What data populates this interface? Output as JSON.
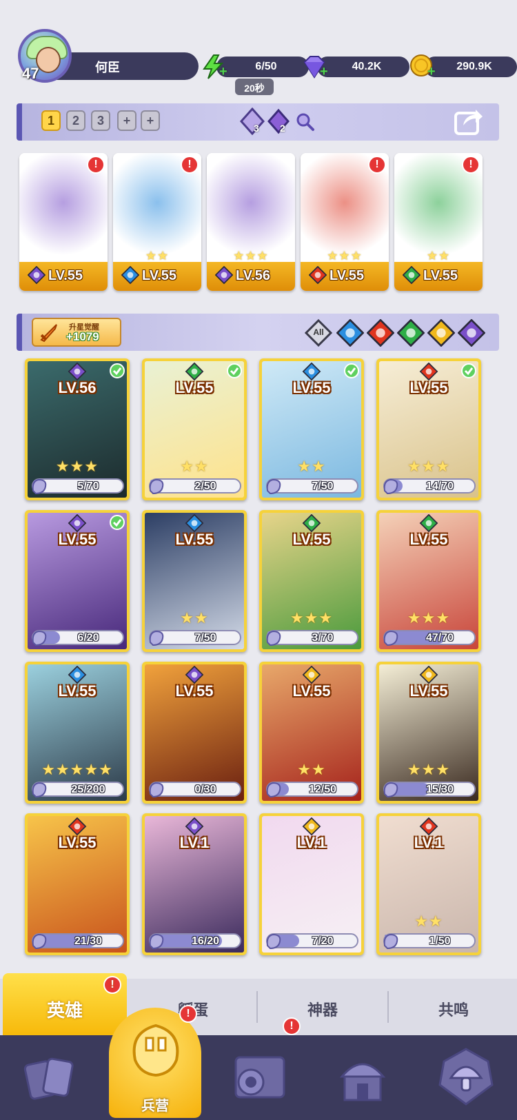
{
  "player": {
    "level": "47",
    "name": "何臣"
  },
  "resources": {
    "energy": {
      "value": "6/50",
      "icon": "lightning-icon",
      "timer": "20秒"
    },
    "gems": {
      "value": "40.2K",
      "icon": "diamond-icon"
    },
    "gold": {
      "value": "290.9K",
      "icon": "coin-icon"
    }
  },
  "team_bar": {
    "slots": [
      "1",
      "2",
      "3"
    ],
    "add_slots": [
      "+",
      "+"
    ],
    "active_slot": "1",
    "counters": [
      {
        "icon": "crystal-icon",
        "value": "3"
      },
      {
        "icon": "moon-crystal-icon",
        "value": "2"
      }
    ]
  },
  "team": [
    {
      "level": "LV.55",
      "element": "moon",
      "stars": "",
      "alert": "!"
    },
    {
      "level": "LV.55",
      "element": "water",
      "stars": "★★",
      "alert": "!"
    },
    {
      "level": "LV.56",
      "element": "moon",
      "stars": "★★★",
      "alert": ""
    },
    {
      "level": "LV.55",
      "element": "fire",
      "stars": "★★★",
      "alert": "!"
    },
    {
      "level": "LV.55",
      "element": "nature",
      "stars": "★★",
      "alert": "!"
    }
  ],
  "filter": {
    "awaken_label": "升星觉醒",
    "awaken_value": "+1079",
    "all_label": "All",
    "elements": [
      "water",
      "fire",
      "nature",
      "light",
      "moon"
    ]
  },
  "heroes": [
    {
      "level": "LV.56",
      "element": "moon",
      "stars": "★★★",
      "progress": "5/70",
      "ratio": 0.07,
      "ready": true,
      "bg": [
        "#3b6b6c",
        "#1c2a2c"
      ]
    },
    {
      "level": "LV.55",
      "element": "nature",
      "stars": "★★",
      "progress": "2/50",
      "ratio": 0.04,
      "ready": true,
      "bg": [
        "#e9f1d4",
        "#ffe28a"
      ]
    },
    {
      "level": "LV.55",
      "element": "water",
      "stars": "★★",
      "progress": "7/50",
      "ratio": 0.14,
      "ready": true,
      "bg": [
        "#cfe9f6",
        "#7bb8e0"
      ]
    },
    {
      "level": "LV.55",
      "element": "fire",
      "stars": "★★★",
      "progress": "14/70",
      "ratio": 0.2,
      "ready": true,
      "bg": [
        "#f6edd6",
        "#d9c28a"
      ]
    },
    {
      "level": "LV.55",
      "element": "moon",
      "stars": "",
      "progress": "6/20",
      "ratio": 0.3,
      "ready": true,
      "bg": [
        "#b89ae0",
        "#47287a"
      ]
    },
    {
      "level": "LV.55",
      "element": "water",
      "stars": "★★",
      "progress": "7/50",
      "ratio": 0.14,
      "ready": false,
      "bg": [
        "#2c3e64",
        "#d4dbe8"
      ]
    },
    {
      "level": "LV.55",
      "element": "nature",
      "stars": "★★★",
      "progress": "3/70",
      "ratio": 0.04,
      "ready": false,
      "bg": [
        "#e7d48a",
        "#4a9a3c"
      ]
    },
    {
      "level": "LV.55",
      "element": "nature",
      "stars": "★★★",
      "progress": "47/70",
      "ratio": 0.67,
      "ready": false,
      "bg": [
        "#f4d1b8",
        "#c8453a"
      ]
    },
    {
      "level": "LV.55",
      "element": "water",
      "stars": "★★★★★",
      "progress": "25/200",
      "ratio": 0.13,
      "ready": false,
      "bg": [
        "#9bd0de",
        "#2c3a48"
      ]
    },
    {
      "level": "LV.55",
      "element": "moon",
      "stars": "",
      "progress": "0/30",
      "ratio": 0.0,
      "ready": false,
      "bg": [
        "#f1a23c",
        "#6a1f10"
      ]
    },
    {
      "level": "LV.55",
      "element": "light",
      "stars": "★★",
      "progress": "12/50",
      "ratio": 0.24,
      "ready": false,
      "bg": [
        "#e8a86a",
        "#a5231c"
      ]
    },
    {
      "level": "LV.55",
      "element": "light",
      "stars": "★★★",
      "progress": "15/30",
      "ratio": 0.5,
      "ready": false,
      "bg": [
        "#f4eed6",
        "#3a2a20"
      ]
    },
    {
      "level": "LV.55",
      "element": "fire",
      "stars": "",
      "progress": "21/30",
      "ratio": 0.7,
      "ready": false,
      "bg": [
        "#f7c44a",
        "#c8521c"
      ]
    },
    {
      "level": "LV.1",
      "element": "moon",
      "stars": "",
      "progress": "16/20",
      "ratio": 0.8,
      "ready": false,
      "bg": [
        "#e9b7d8",
        "#3a2a5c"
      ]
    },
    {
      "level": "LV.1",
      "element": "light",
      "stars": "",
      "progress": "7/20",
      "ratio": 0.35,
      "ready": false,
      "bg": [
        "#f1d9ef",
        "#f6f0f4"
      ]
    },
    {
      "level": "LV.1",
      "element": "fire",
      "stars": "★★",
      "progress": "1/50",
      "ratio": 0.02,
      "ready": false,
      "bg": [
        "#f0ddd0",
        "#c9b6ac"
      ]
    }
  ],
  "tabs": [
    {
      "label": "英雄",
      "active": true,
      "alert": "!"
    },
    {
      "label": "孵蛋",
      "active": false
    },
    {
      "label": "神器",
      "active": false
    },
    {
      "label": "共鸣",
      "active": false
    }
  ],
  "nav": [
    {
      "icon": "cards-icon",
      "label": ""
    },
    {
      "icon": "barracks-icon",
      "label": "兵营",
      "active": true,
      "alert": "!"
    },
    {
      "icon": "map-icon",
      "label": "",
      "alert": "!"
    },
    {
      "icon": "temple-icon",
      "label": ""
    },
    {
      "icon": "mushroom-icon",
      "label": ""
    }
  ],
  "colors": {
    "moon": "#7a4fc9",
    "water": "#2a8ee0",
    "fire": "#e0341e",
    "nature": "#2eae47",
    "light": "#f0b81c",
    "accent": "#ffd54a",
    "panel": "#3b3a5c"
  }
}
